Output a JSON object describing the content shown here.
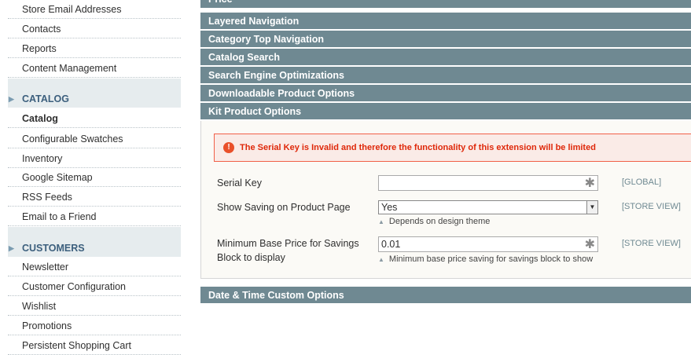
{
  "sidebar": {
    "top_items": [
      "Store Email Addresses",
      "Contacts",
      "Reports",
      "Content Management"
    ],
    "catalog": {
      "heading": "CATALOG",
      "items": [
        "Catalog",
        "Configurable Swatches",
        "Inventory",
        "Google Sitemap",
        "RSS Feeds",
        "Email to a Friend"
      ]
    },
    "customers": {
      "heading": "CUSTOMERS",
      "items": [
        "Newsletter",
        "Customer Configuration",
        "Wishlist",
        "Promotions",
        "Persistent Shopping Cart"
      ]
    }
  },
  "sections": [
    "Price",
    "Layered Navigation",
    "Category Top Navigation",
    "Catalog Search",
    "Search Engine Optimizations",
    "Downloadable Product Options",
    "Kit Product Options"
  ],
  "kit_options": {
    "error_message": "The Serial Key is Invalid and therefore the functionality of this extension will be limited",
    "serial_key": {
      "label": "Serial Key",
      "value": "",
      "scope": "[GLOBAL]"
    },
    "show_saving": {
      "label": "Show Saving on Product Page",
      "value": "Yes",
      "note": "Depends on design theme",
      "scope": "[STORE VIEW]"
    },
    "min_price": {
      "label_line1": "Minimum Base Price for Savings",
      "label_line2": "Block to display",
      "value": "0.01",
      "note": "Minimum base price saving for savings block to show",
      "scope": "[STORE VIEW]"
    }
  },
  "bottom_section": "Date & Time Custom Options",
  "icons": {
    "required": "asterisk-icon",
    "error": "error-icon",
    "dropdown": "dropdown-arrow-icon",
    "note": "note-triangle-icon",
    "section_arrow": "section-arrow-icon"
  }
}
